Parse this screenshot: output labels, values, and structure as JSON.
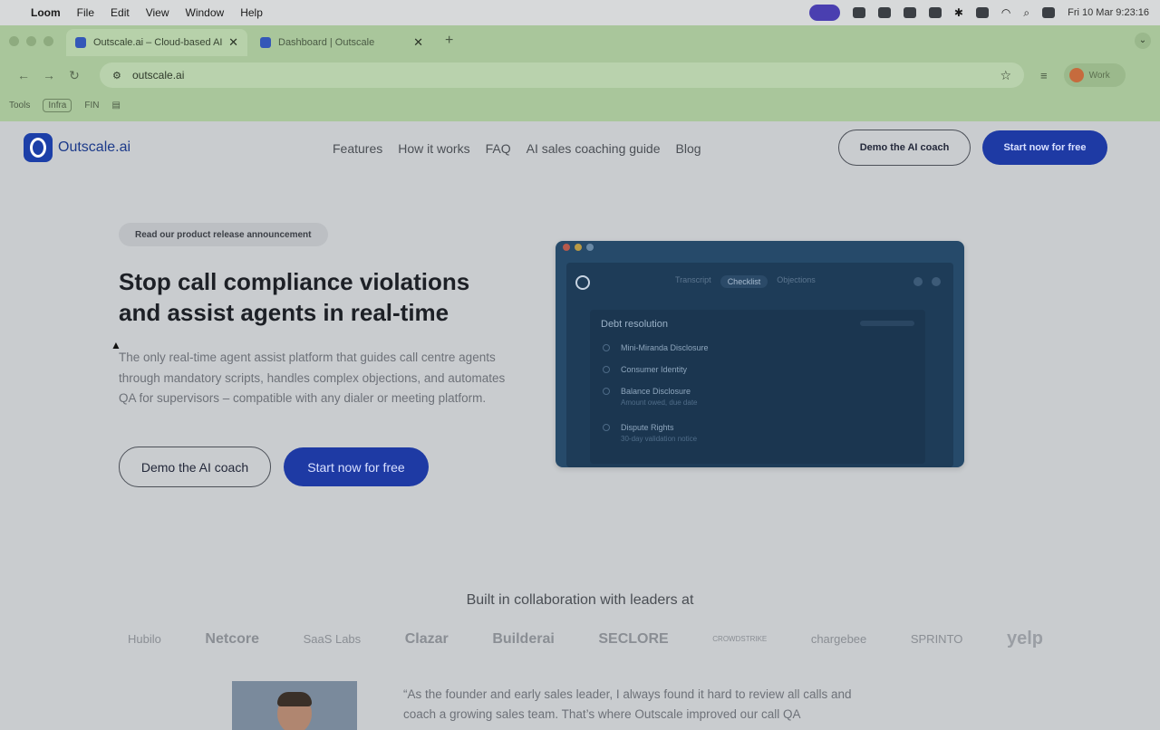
{
  "menubar": {
    "app": "Loom",
    "menus": [
      "File",
      "Edit",
      "View",
      "Window",
      "Help"
    ],
    "clock": "Fri 10 Mar  9:23:16"
  },
  "browser": {
    "tabs": [
      {
        "title": "Outscale.ai – Cloud-based AI sal…",
        "active": true
      },
      {
        "title": "Dashboard | Outscale",
        "active": false
      }
    ],
    "new_tab": "+",
    "url": "outscale.ai",
    "profile_label": "Work",
    "bookmarks": [
      "Tools",
      "Infra",
      "FIN"
    ]
  },
  "site": {
    "brand": "Outscale.ai",
    "nav": [
      "Features",
      "How it works",
      "FAQ",
      "AI sales coaching guide",
      "Blog"
    ],
    "demo_label": "Demo the AI coach",
    "start_label": "Start now for free",
    "announcement": "Read our product release announcement",
    "headline": "Stop call compliance violations and assist agents in real-time",
    "description": "The only real-time agent assist platform that guides call centre agents through mandatory scripts, handles complex objections, and automates QA for supervisors – compatible with any dialer or meeting platform.",
    "mock": {
      "tabs": [
        "Transcript",
        "Checklist",
        "Objections"
      ],
      "panel_title": "Debt resolution",
      "items": [
        {
          "label": "Mini-Miranda Disclosure",
          "sub": ""
        },
        {
          "label": "Consumer Identity",
          "sub": ""
        },
        {
          "label": "Balance Disclosure",
          "sub": "Amount owed, due date"
        },
        {
          "label": "Dispute Rights",
          "sub": "30-day validation notice"
        }
      ]
    },
    "built_title": "Built in collaboration with leaders at",
    "logos": [
      "Hubilo",
      "Netcore",
      "SaaS Labs",
      "Clazar",
      "Builderai",
      "SECLORE",
      "CROWDSTRIKE",
      "chargebee",
      "SPRINTO",
      "yelp"
    ],
    "quote": "“As the founder and early sales leader, I always found it hard to review all calls and coach a growing sales team. That’s where Outscale improved our call QA"
  },
  "colors": {
    "brand": "#1e3aa4",
    "chrome_tint": "#a9c69b",
    "page_bg": "#c9cccf"
  }
}
